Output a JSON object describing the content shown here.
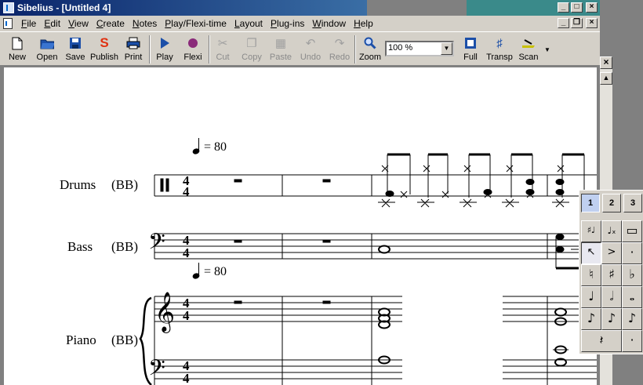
{
  "window": {
    "title": "Sibelius - [Untitled 4]",
    "minimize": "_",
    "maximize": "□",
    "close": "×",
    "restore": "❐"
  },
  "menu": [
    "File",
    "Edit",
    "View",
    "Create",
    "Notes",
    "Play/Flexi-time",
    "Layout",
    "Plug-ins",
    "Window",
    "Help"
  ],
  "toolbar": {
    "new": "New",
    "open": "Open",
    "save": "Save",
    "publish": "Publish",
    "print": "Print",
    "play": "Play",
    "flexi": "Flexi",
    "cut": "Cut",
    "copy": "Copy",
    "paste": "Paste",
    "undo": "Undo",
    "redo": "Redo",
    "zoom": "Zoom",
    "zoom_value": "100 %",
    "full": "Full",
    "transp": "Transp",
    "scan": "Scan"
  },
  "score": {
    "tempo_1": "= 80",
    "tempo_2": "= 80",
    "staves": [
      {
        "name": "Drums",
        "tag": "(BB)"
      },
      {
        "name": "Bass",
        "tag": "(BB)"
      },
      {
        "name": "Piano",
        "tag": "(BB)"
      }
    ],
    "time_signature": "4/4"
  },
  "keypad": {
    "tabs": [
      "1",
      "2",
      "3"
    ],
    "keys": [
      "♯♩",
      "♩ₓ",
      "▭",
      "↖",
      ">",
      "·",
      "♮",
      "♯",
      "♭",
      "♩",
      "𝅗𝅥",
      "𝅝",
      "♪",
      "♪",
      "♪",
      "𝄽",
      "·"
    ]
  },
  "colors": {
    "title_active": "#0a246a",
    "title_inactive": "#3a8a8a",
    "chrome": "#d4d0c8"
  }
}
